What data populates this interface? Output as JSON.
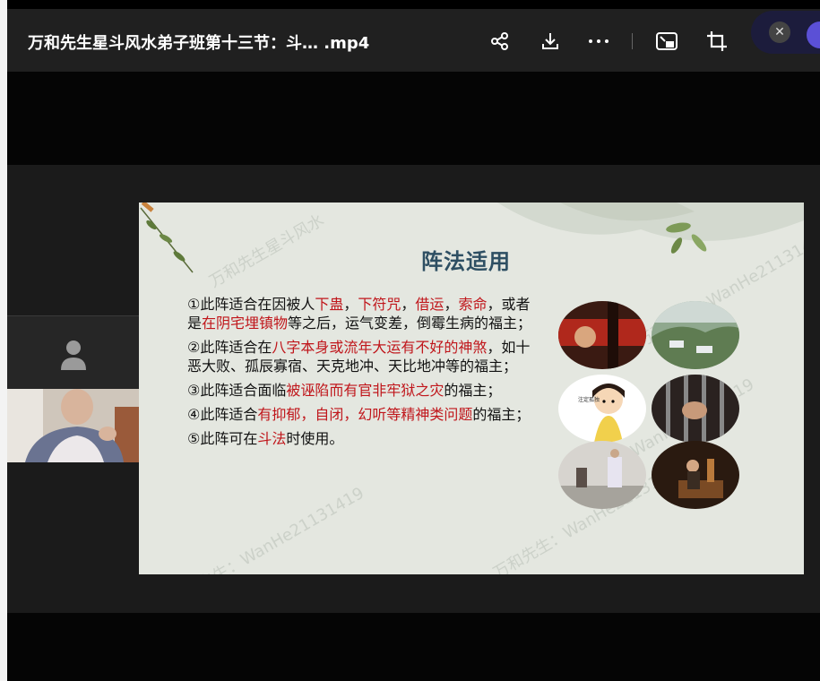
{
  "window": {
    "title": "万和先生星斗风水弟子班第十三节：斗…   .mp4"
  },
  "toolbar": {
    "icons": [
      "share-icon",
      "download-icon",
      "more-icon",
      "picture-in-picture-icon",
      "crop-icon"
    ],
    "close_label": "✕"
  },
  "slide": {
    "title": "阵法适用",
    "points": [
      {
        "parts": [
          {
            "t": "①此阵适合在因被人",
            "red": false
          },
          {
            "t": "下蛊",
            "red": true
          },
          {
            "t": "，",
            "red": false
          },
          {
            "t": "下符咒",
            "red": true
          },
          {
            "t": "，",
            "red": false
          },
          {
            "t": "借运",
            "red": true
          },
          {
            "t": "，",
            "red": false
          },
          {
            "t": "索命",
            "red": true
          },
          {
            "t": "，或者是",
            "red": false
          },
          {
            "t": "在阴宅埋镇物",
            "red": true
          },
          {
            "t": "等之后，运气变差，倒霉生病的福主；",
            "red": false
          }
        ]
      },
      {
        "parts": [
          {
            "t": "②此阵适合在",
            "red": false
          },
          {
            "t": "八字本身或流年大运有不好的神煞",
            "red": true
          },
          {
            "t": "，如十恶大败、孤辰寡宿、天克地冲、天比地冲等的福主；",
            "red": false
          }
        ]
      },
      {
        "parts": [
          {
            "t": "③此阵适合面临",
            "red": false
          },
          {
            "t": "被诬陷而有官非牢狱之灾",
            "red": true
          },
          {
            "t": "的福主；",
            "red": false
          }
        ]
      },
      {
        "parts": [
          {
            "t": "④此阵适合",
            "red": false
          },
          {
            "t": "有抑郁，自闭，幻听等精神类问题",
            "red": true
          },
          {
            "t": "的福主；",
            "red": false
          }
        ]
      },
      {
        "parts": [
          {
            "t": "⑤此阵可在",
            "red": false
          },
          {
            "t": "斗法",
            "red": true
          },
          {
            "t": "时使用。",
            "red": false
          }
        ]
      }
    ],
    "watermarks": [
      "万和先生星斗风水",
      "万和先生：WanHe2113141 9",
      "万和先生：WanHe21131419",
      "WanHe21131419",
      "万和先生：WanHe21131419"
    ],
    "photo_icons": [
      "ritual-scene-photo",
      "mountain-village-photo",
      "cartoon-girl-photo",
      "prison-bars-photo",
      "hospital-room-photo",
      "incense-ceremony-photo"
    ]
  },
  "colors": {
    "slide_bg": "#e4e7e0",
    "title_color": "#2e4f63",
    "red_text": "#c0161b",
    "titlebar_bg": "#202020"
  }
}
